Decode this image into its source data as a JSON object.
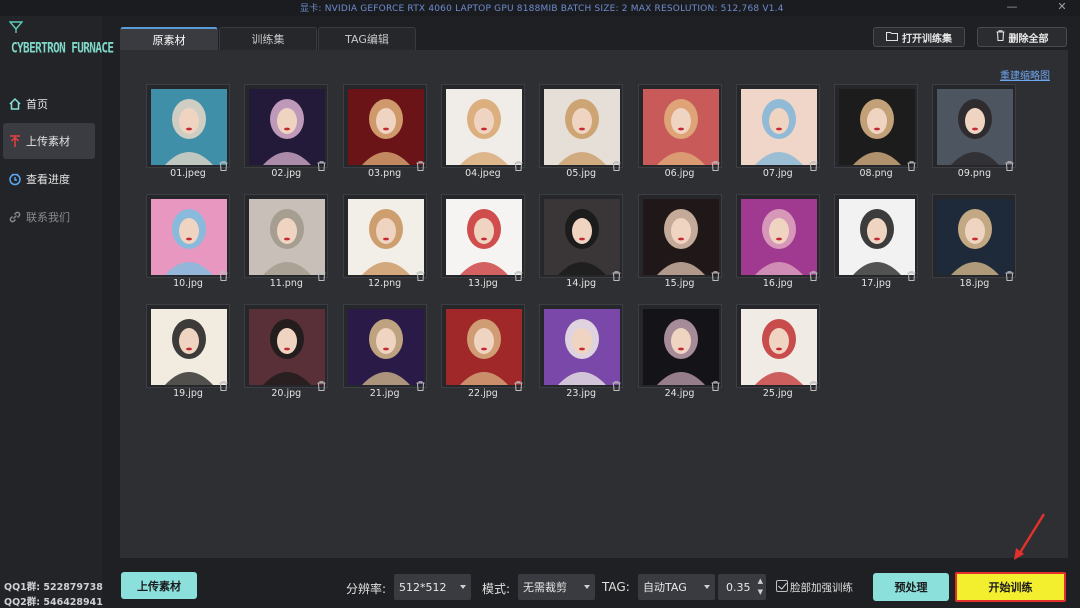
{
  "titlebar": {
    "info": "显卡: NVIDIA GEFORCE RTX 4060 LAPTOP GPU 8188MIB  BATCH SIZE: 2  MAX RESOLUTION: 512,768 V1.4",
    "minimize": "—",
    "close": "✕"
  },
  "sidebar": {
    "logo_text": "CYBERTRON FURNACE",
    "items": [
      {
        "label": "首页",
        "icon": "home-icon"
      },
      {
        "label": "上传素材",
        "icon": "upload-icon",
        "active": true
      },
      {
        "label": "查看进度",
        "icon": "progress-icon"
      },
      {
        "label": "联系我们",
        "icon": "link-icon",
        "disabled": true
      }
    ],
    "qq": [
      "QQ1群: 522879738",
      "QQ2群: 546428941"
    ]
  },
  "tabs": [
    {
      "label": "原素材",
      "active": true
    },
    {
      "label": "训练集"
    },
    {
      "label": "TAG编辑"
    }
  ],
  "toolbar": {
    "open_training_set": "打开训练集",
    "delete_all": "删除全部"
  },
  "panel": {
    "rebuild_thumbs": "重建缩略图",
    "images": [
      {
        "name": "01.jpeg",
        "bg": "#3f8fa8",
        "fg": "#e9d9c8"
      },
      {
        "name": "02.jpg",
        "bg": "#221a38",
        "fg": "#d9b0d0"
      },
      {
        "name": "03.png",
        "bg": "#6a1418",
        "fg": "#e0b07a"
      },
      {
        "name": "04.jpeg",
        "bg": "#f0ece8",
        "fg": "#d8a46c"
      },
      {
        "name": "05.jpg",
        "bg": "#e6dfd8",
        "fg": "#c89a62"
      },
      {
        "name": "06.jpg",
        "bg": "#c95a5a",
        "fg": "#e2b07c"
      },
      {
        "name": "07.jpg",
        "bg": "#f0d6c8",
        "fg": "#7fb5d8"
      },
      {
        "name": "08.png",
        "bg": "#1c1c1c",
        "fg": "#e0b888"
      },
      {
        "name": "09.png",
        "bg": "#4c5560",
        "fg": "#2a2628"
      },
      {
        "name": "10.jpg",
        "bg": "#e898c0",
        "fg": "#78c0e0"
      },
      {
        "name": "11.png",
        "bg": "#c8c0b8",
        "fg": "#a09888"
      },
      {
        "name": "12.png",
        "bg": "#f2eee8",
        "fg": "#c89058"
      },
      {
        "name": "13.jpg",
        "bg": "#f6f4f2",
        "fg": "#c83030"
      },
      {
        "name": "14.jpg",
        "bg": "#3a3638",
        "fg": "#181818"
      },
      {
        "name": "15.jpg",
        "bg": "#201818",
        "fg": "#e0c4b0"
      },
      {
        "name": "16.jpg",
        "bg": "#a03a90",
        "fg": "#e0a8c0"
      },
      {
        "name": "17.jpg",
        "bg": "#f2f2f2",
        "fg": "#1c1c1c"
      },
      {
        "name": "18.jpg",
        "bg": "#1e2a3a",
        "fg": "#e0c090"
      },
      {
        "name": "19.jpg",
        "bg": "#f2ece0",
        "fg": "#1c1c1c"
      },
      {
        "name": "20.jpg",
        "bg": "#5a3038",
        "fg": "#1a1a1a"
      },
      {
        "name": "21.jpg",
        "bg": "#2a1a48",
        "fg": "#d8bc8c"
      },
      {
        "name": "22.jpg",
        "bg": "#a02828",
        "fg": "#d8b080"
      },
      {
        "name": "23.jpg",
        "bg": "#7a48a8",
        "fg": "#f0ece8"
      },
      {
        "name": "24.jpg",
        "bg": "#141418",
        "fg": "#c0a0b0"
      },
      {
        "name": "25.jpg",
        "bg": "#f0ebe4",
        "fg": "#c03030"
      }
    ]
  },
  "bottom": {
    "upload_button": "上传素材",
    "resolution_label": "分辨率:",
    "resolution_value": "512*512",
    "mode_label": "模式:",
    "mode_value": "无需裁剪",
    "tag_label": "TAG:",
    "tag_value": "自动TAG",
    "threshold": "0.35",
    "face_enhance_label": "脸部加强训练",
    "face_enhance_checked": true,
    "preprocess_button": "预处理",
    "start_button": "开始训练"
  },
  "colors": {
    "accent_teal": "#8be0dc",
    "start_yellow": "#f4ef2e",
    "highlight_red": "#e2312c",
    "link_blue": "#6ea6f0"
  }
}
